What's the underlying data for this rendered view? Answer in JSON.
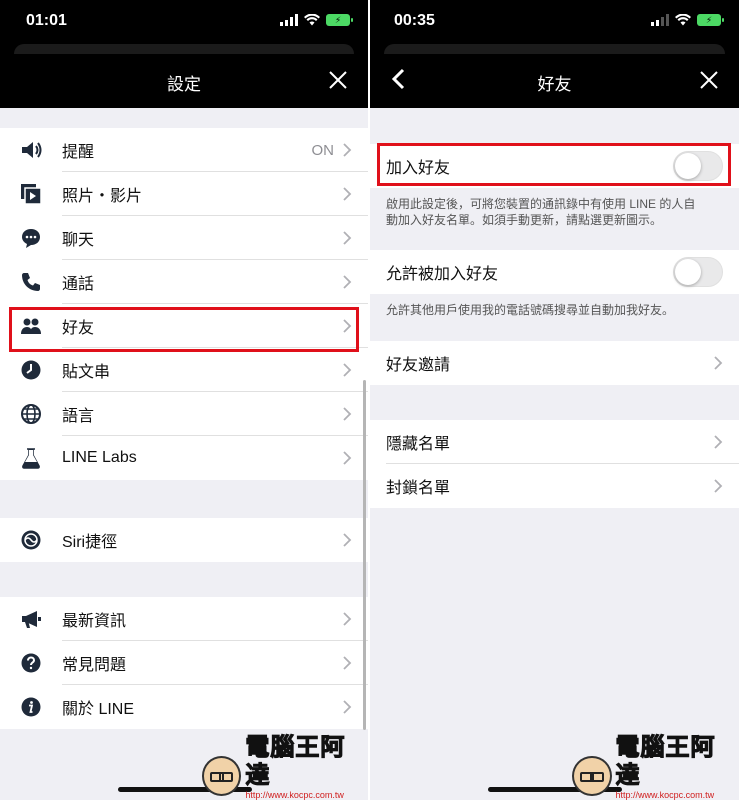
{
  "left": {
    "status": {
      "time": "01:01"
    },
    "nav": {
      "title": "設定"
    },
    "items": [
      {
        "label": "提醒",
        "value": "ON",
        "icon": "speaker-icon"
      },
      {
        "label": "照片・影片",
        "icon": "photo-video-icon"
      },
      {
        "label": "聊天",
        "icon": "chat-bubble-icon"
      },
      {
        "label": "通話",
        "icon": "phone-icon"
      },
      {
        "label": "好友",
        "icon": "friends-icon"
      },
      {
        "label": "貼文串",
        "icon": "timeline-clock-icon"
      },
      {
        "label": "語言",
        "icon": "globe-icon"
      },
      {
        "label": "LINE Labs",
        "icon": "flask-icon"
      },
      {
        "label": "Siri捷徑",
        "icon": "siri-icon"
      },
      {
        "label": "最新資訊",
        "icon": "megaphone-icon"
      },
      {
        "label": "常見問題",
        "icon": "question-icon"
      },
      {
        "label": "關於 LINE",
        "icon": "info-icon"
      }
    ]
  },
  "right": {
    "status": {
      "time": "00:35"
    },
    "nav": {
      "title": "好友"
    },
    "add_friends": {
      "label": "加入好友",
      "enabled": false,
      "desc_line1": "啟用此設定後，可將您裝置的通訊錄中有使用 LINE 的人自",
      "desc_line2": "動加入好友名單。如須手動更新，請點選更新圖示。"
    },
    "allow_add": {
      "label": "允許被加入好友",
      "enabled": false,
      "desc": "允許其他用戶使用我的電話號碼搜尋並自動加我好友。"
    },
    "invite": {
      "label": "好友邀請"
    },
    "hidden": {
      "label": "隱藏名單"
    },
    "blocked": {
      "label": "封鎖名單"
    }
  },
  "watermark": {
    "brand": "電腦王阿達",
    "url": "http://www.kocpc.com.tw"
  },
  "colors": {
    "highlight": "#e0101a",
    "battery": "#4cd964",
    "background": "#efeff4"
  }
}
